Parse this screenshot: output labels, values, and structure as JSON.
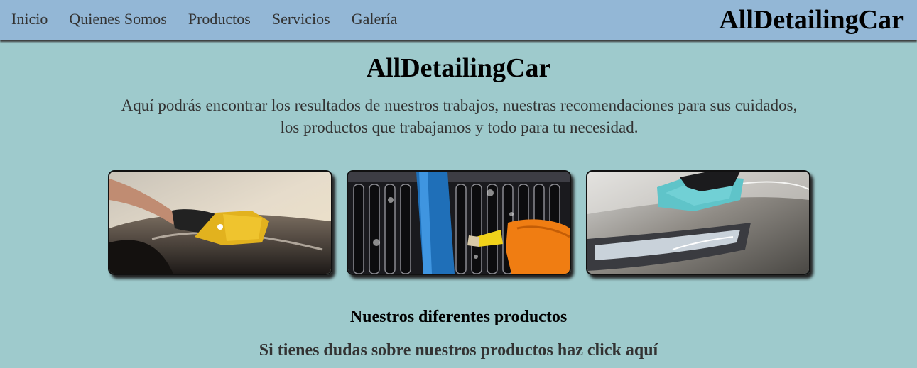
{
  "nav": {
    "items": [
      {
        "label": "Inicio"
      },
      {
        "label": "Quienes Somos"
      },
      {
        "label": "Productos"
      },
      {
        "label": "Servicios"
      },
      {
        "label": "Galería"
      }
    ],
    "brand": "AllDetailingCar"
  },
  "main": {
    "title": "AllDetailingCar",
    "intro": "Aquí podrás encontrar los resultados de nuestros trabajos, nuestras recomendaciones para sus cuidados, los productos que trabajamos y todo para tu necesidad.",
    "gallery": [
      {
        "subject": "gloved hand polishing car hood with yellow cloth"
      },
      {
        "subject": "brush cleaning car front grille with foam"
      },
      {
        "subject": "gloved hand wiping car hood with teal microfiber cloth"
      }
    ],
    "products_heading": "Nuestros diferentes productos",
    "help_link": "Si tienes dudas sobre nuestros productos haz click aquí"
  },
  "colors": {
    "page_background": "#9ecacc",
    "navbar_background": "#93b7d6"
  }
}
